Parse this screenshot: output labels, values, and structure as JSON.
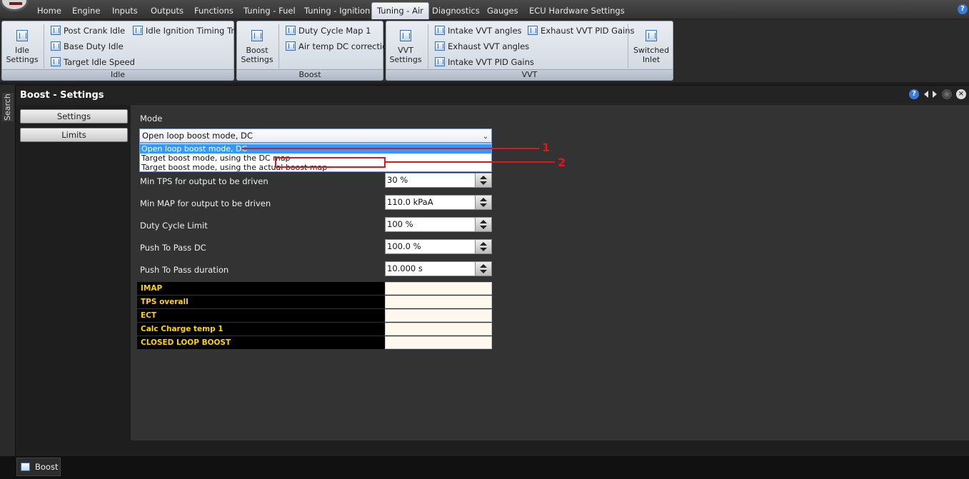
{
  "menu": {
    "tabs": [
      "Home",
      "Engine",
      "Inputs",
      "Outputs",
      "Functions",
      "Tuning - Fuel",
      "Tuning - Ignition",
      "Tuning - Air",
      "Diagnostics",
      "Gauges",
      "ECU Hardware Settings"
    ],
    "active_tab": "Tuning - Air",
    "help_glyph": "?"
  },
  "ribbon": {
    "idle": {
      "label": "Idle",
      "big_button": "Idle Settings",
      "items": [
        "Post Crank Idle",
        "Base Duty Idle",
        "Target Idle Speed",
        "Idle Ignition Timing Trim"
      ]
    },
    "boost": {
      "label": "Boost",
      "big_button": "Boost Settings",
      "items": [
        "Duty Cycle Map 1",
        "Air temp DC correction"
      ]
    },
    "vvt": {
      "label": "VVT",
      "big_button": "VVT Settings",
      "items": [
        "Intake VVT angles",
        "Exhaust VVT angles",
        "Intake VVT PID Gains",
        "Exhaust VVT PID Gains"
      ],
      "big_button_2": "Switched Inlet"
    }
  },
  "sidebar": {
    "search_label": "Search"
  },
  "panel": {
    "title": "Boost - Settings",
    "nav": [
      "Settings",
      "Limits"
    ]
  },
  "form": {
    "mode_label": "Mode",
    "mode_value": "Open loop boost mode, DC",
    "mode_options": [
      "Open loop boost mode, DC",
      "Target boost mode, using the DC map",
      "Target boost mode, using the actual boost map"
    ],
    "fields": [
      {
        "label": "Min TPS for output to be driven",
        "value": "30 %"
      },
      {
        "label": "Min MAP for output to be driven",
        "value": "110.0 kPaA"
      },
      {
        "label": "Duty Cycle Limit",
        "value": "100 %"
      },
      {
        "label": "Push To Pass DC",
        "value": "100.0 %"
      },
      {
        "label": "Push To Pass duration",
        "value": "10.000 s"
      }
    ],
    "runtime": [
      "IMAP",
      "TPS overall",
      "ECT",
      "Calc Charge temp 1",
      "CLOSED LOOP BOOST"
    ]
  },
  "annotations": {
    "one": "1",
    "two": "2",
    "color": "#e0161b"
  },
  "bottom": {
    "tab": "Boost"
  },
  "colors": {
    "accent": "#3399ff",
    "runtime_label": "#ffd400"
  }
}
